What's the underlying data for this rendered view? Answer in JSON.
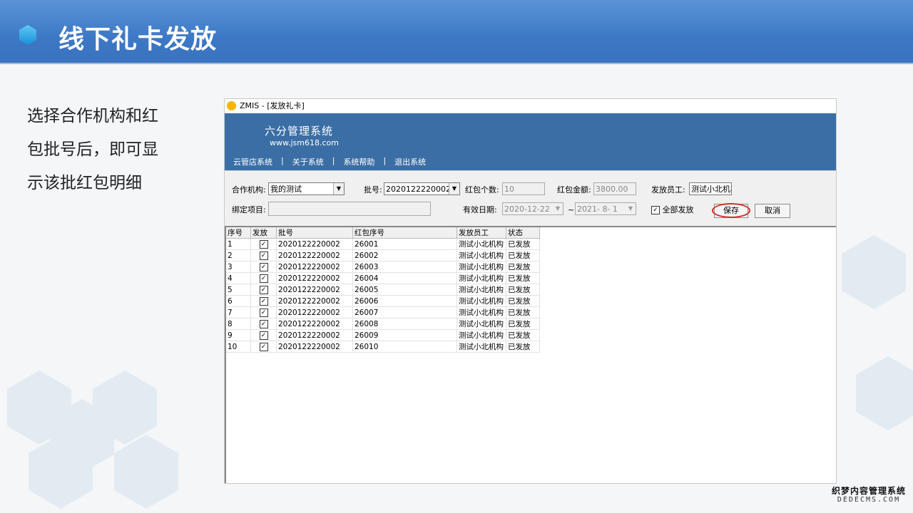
{
  "slide": {
    "title": "线下礼卡发放",
    "description": "选择合作机构和红包批号后，即可显示该批红包明细"
  },
  "window": {
    "title": "ZMIS - [发放礼卡]",
    "system_name": "六分管理系统",
    "system_url": "www.jsm618.com",
    "menu": [
      "云管店系统",
      "关于系统",
      "系统帮助",
      "退出系统"
    ]
  },
  "form": {
    "partner_label": "合作机构:",
    "partner_value": "我的测试",
    "batch_label": "批号:",
    "batch_value": "2020122220002",
    "count_label": "红包个数:",
    "count_value": "10",
    "amount_label": "红包金额:",
    "amount_value": "3800.00",
    "staff_label": "发放员工:",
    "staff_value": "测试小北机构",
    "bind_label": "绑定项目:",
    "bind_value": "",
    "valid_label": "有效日期:",
    "date_from": "2020-12-22",
    "date_sep": "~",
    "date_to": "2021- 8- 1",
    "all_issue_label": "全部发放",
    "all_issue_checked": true,
    "save_label": "保存",
    "cancel_label": "取消"
  },
  "grid": {
    "columns": [
      "序号",
      "发放",
      "批号",
      "红包序号",
      "发放员工",
      "状态"
    ],
    "rows": [
      [
        "1",
        "✓",
        "2020122220002",
        "26001",
        "测试小北机构",
        "已发放"
      ],
      [
        "2",
        "✓",
        "2020122220002",
        "26002",
        "测试小北机构",
        "已发放"
      ],
      [
        "3",
        "✓",
        "2020122220002",
        "26003",
        "测试小北机构",
        "已发放"
      ],
      [
        "4",
        "✓",
        "2020122220002",
        "26004",
        "测试小北机构",
        "已发放"
      ],
      [
        "5",
        "✓",
        "2020122220002",
        "26005",
        "测试小北机构",
        "已发放"
      ],
      [
        "6",
        "✓",
        "2020122220002",
        "26006",
        "测试小北机构",
        "已发放"
      ],
      [
        "7",
        "✓",
        "2020122220002",
        "26007",
        "测试小北机构",
        "已发放"
      ],
      [
        "8",
        "✓",
        "2020122220002",
        "26008",
        "测试小北机构",
        "已发放"
      ],
      [
        "9",
        "✓",
        "2020122220002",
        "26009",
        "测试小北机构",
        "已发放"
      ],
      [
        "10",
        "✓",
        "2020122220002",
        "26010",
        "测试小北机构",
        "已发放"
      ]
    ]
  },
  "watermark": {
    "line1": "织梦内容管理系统",
    "line2": "DEDECMS.COM"
  }
}
